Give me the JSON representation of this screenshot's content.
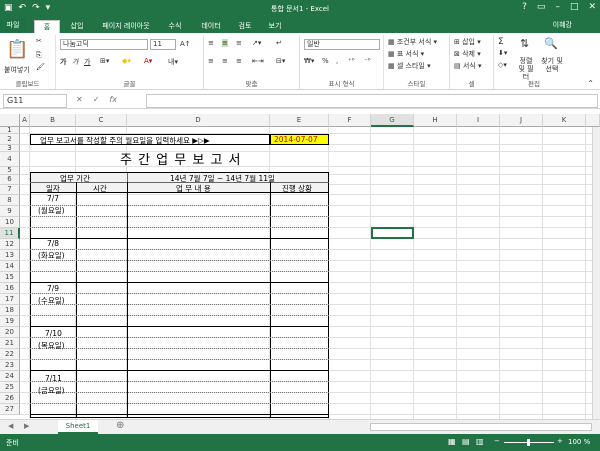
{
  "app": {
    "title": "통합 문서1 - Excel",
    "user": "이혜강",
    "qat_icons": [
      "save-icon",
      "undo-icon",
      "redo-icon",
      "customize-icon"
    ]
  },
  "tabs": [
    "파일",
    "홈",
    "삽입",
    "페이지 레이아웃",
    "수식",
    "데이터",
    "검토",
    "보기"
  ],
  "ribbon": {
    "clipboard": {
      "paste": "붙여넣기",
      "label": "클립보드"
    },
    "font": {
      "name": "나눔고딕",
      "size": "11",
      "bold": "가",
      "italic": "가",
      "underline": "가",
      "label": "글꼴"
    },
    "align": {
      "label": "맞춤"
    },
    "number": {
      "format": "일반",
      "percent": "%",
      "comma": ",",
      "label": "표시 형식"
    },
    "style": {
      "cond": "조건부 서식",
      "table": "표 서식",
      "cell": "셀 스타일",
      "label": "스타일"
    },
    "cells": {
      "insert": "삽입",
      "delete": "삭제",
      "format": "서식",
      "label": "셀"
    },
    "edit": {
      "sum": "Σ",
      "sort": "정렬 및 필터",
      "find": "찾기 및 선택",
      "label": "편집"
    }
  },
  "formula_bar": {
    "name_box": "G11",
    "fx": "fx",
    "value": ""
  },
  "columns": [
    "A",
    "B",
    "C",
    "D",
    "E",
    "F",
    "G",
    "H",
    "I",
    "J",
    "K"
  ],
  "selected_column": "G",
  "selected_row": "11",
  "rows": [
    "1",
    "2",
    "3",
    "4",
    "5",
    "6",
    "7",
    "8",
    "9",
    "10",
    "11",
    "12",
    "13",
    "14",
    "15",
    "16",
    "17",
    "18",
    "19",
    "20",
    "21",
    "22",
    "23",
    "24",
    "25",
    "26",
    "27"
  ],
  "sheet": {
    "instruction": "업무 보고서를 작성할 주의 월요일을 입력하세요 ▶▷▶",
    "date": "2014-07-07",
    "title": "주 간 업 무 보 고 서",
    "period_label": "업무 기간",
    "period_value": "14년 7월 7일 ~ 14년 7월 11일",
    "headers": {
      "date": "일자",
      "time": "시간",
      "content": "업 무 내 용",
      "status": "진행 상황"
    },
    "days": [
      {
        "date": "7/7",
        "day": "(월요일)"
      },
      {
        "date": "7/8",
        "day": "(화요일)"
      },
      {
        "date": "7/9",
        "day": "(수요일)"
      },
      {
        "date": "7/10",
        "day": "(목요일)"
      },
      {
        "date": "7/11",
        "day": "(금요일)"
      }
    ]
  },
  "sheet_tab": "Sheet1",
  "status": {
    "ready": "준비",
    "zoom": "100 %"
  },
  "colors": {
    "accent": "#217346",
    "highlight": "#ffff00"
  }
}
